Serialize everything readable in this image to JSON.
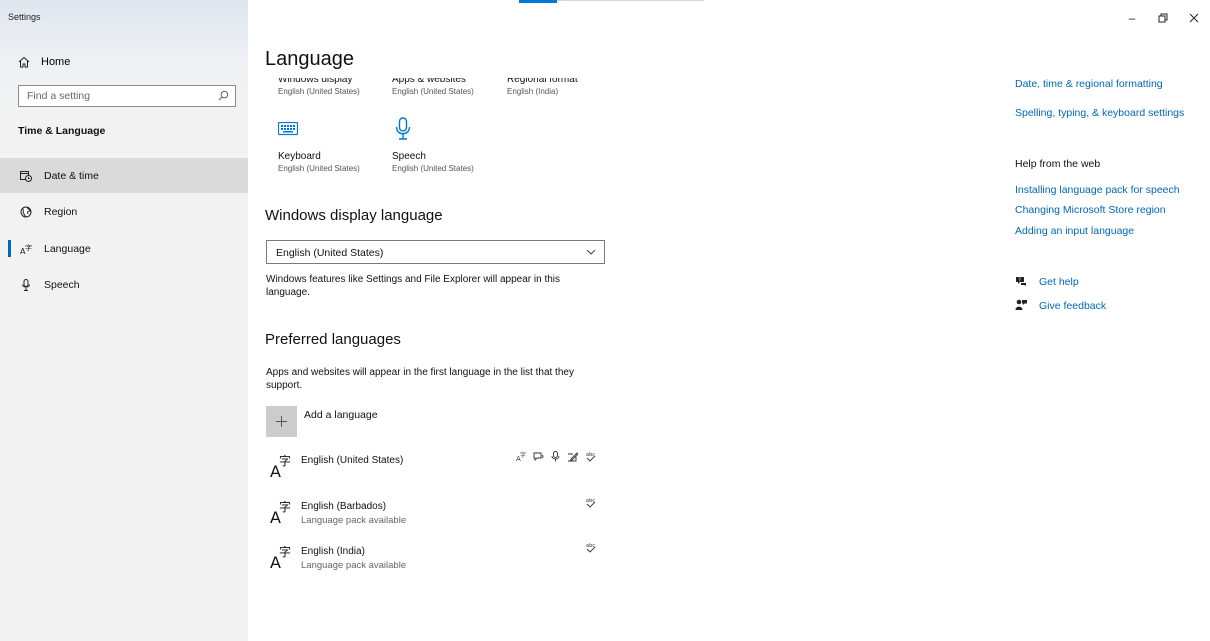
{
  "window": {
    "title": "Settings"
  },
  "sidebar": {
    "home_label": "Home",
    "search_placeholder": "Find a setting",
    "section_title": "Time & Language",
    "items": [
      {
        "label": "Date & time",
        "icon": "calendar-clock-icon"
      },
      {
        "label": "Region",
        "icon": "globe-icon"
      },
      {
        "label": "Language",
        "icon": "language-icon"
      },
      {
        "label": "Speech",
        "icon": "microphone-icon"
      }
    ]
  },
  "main": {
    "title": "Language",
    "tiles": [
      {
        "title": "Windows display",
        "subtitle": "English (United States)",
        "icon": "monitor-icon"
      },
      {
        "title": "Apps & websites",
        "subtitle": "English (United States)",
        "icon": "browser-icon"
      },
      {
        "title": "Regional format",
        "subtitle": "English (India)",
        "icon": "region-icon"
      },
      {
        "title": "Keyboard",
        "subtitle": "English (United States)",
        "icon": "keyboard-icon"
      },
      {
        "title": "Speech",
        "subtitle": "English (United States)",
        "icon": "microphone-icon"
      }
    ],
    "display_language": {
      "heading": "Windows display language",
      "selected": "English (United States)",
      "description": "Windows features like Settings and File Explorer will appear in this language."
    },
    "preferred": {
      "heading": "Preferred languages",
      "description": "Apps and websites will appear in the first language in the list that they support.",
      "add_label": "Add a language",
      "languages": [
        {
          "name": "English (United States)",
          "status": ""
        },
        {
          "name": "English (Barbados)",
          "status": "Language pack available"
        },
        {
          "name": "English (India)",
          "status": "Language pack available"
        }
      ]
    }
  },
  "right_pane": {
    "related_links": [
      "Date, time & regional formatting",
      "Spelling, typing, & keyboard settings"
    ],
    "help_header": "Help from the web",
    "help_links": [
      "Installing language pack for speech",
      "Changing Microsoft Store region",
      "Adding an input language"
    ],
    "get_help": "Get help",
    "give_feedback": "Give feedback"
  },
  "colors": {
    "accent": "#0067b8",
    "sidebar_bg": "#f2f2f2",
    "active_item_bg": "#dadada",
    "button_bg": "#cccccc"
  }
}
